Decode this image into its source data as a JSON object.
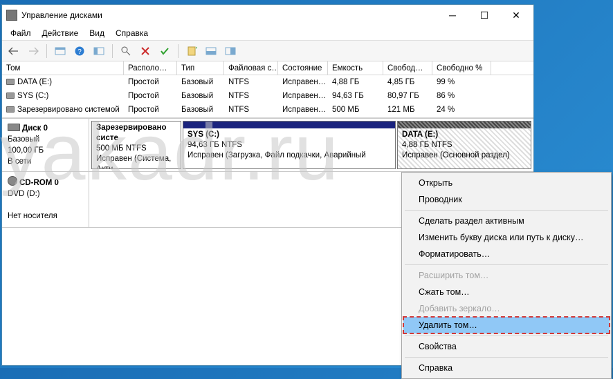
{
  "window": {
    "title": "Управление дисками"
  },
  "menubar": [
    "Файл",
    "Действие",
    "Вид",
    "Справка"
  ],
  "columns": {
    "volume": "Том",
    "location": "Располо…",
    "type": "Тип",
    "fs": "Файловая с…",
    "state": "Состояние",
    "capacity": "Емкость",
    "free": "Свобод…",
    "freePct": "Свободно %"
  },
  "volumes": [
    {
      "name": "DATA (E:)",
      "location": "Простой",
      "type": "Базовый",
      "fs": "NTFS",
      "state": "Исправен…",
      "capacity": "4,88 ГБ",
      "free": "4,85 ГБ",
      "freePct": "99 %"
    },
    {
      "name": "SYS (C:)",
      "location": "Простой",
      "type": "Базовый",
      "fs": "NTFS",
      "state": "Исправен…",
      "capacity": "94,63 ГБ",
      "free": "80,97 ГБ",
      "freePct": "86 %"
    },
    {
      "name": "Зарезервировано системой",
      "location": "Простой",
      "type": "Базовый",
      "fs": "NTFS",
      "state": "Исправен…",
      "capacity": "500 МБ",
      "free": "121 МБ",
      "freePct": "24 %"
    }
  ],
  "disk0": {
    "label": "Диск 0",
    "type": "Базовый",
    "size": "100,00 ГБ",
    "status": "В сети",
    "partitions": [
      {
        "title": "Зарезервировано систе",
        "sub": "500 МБ NTFS",
        "state": "Исправен (Система, Акти"
      },
      {
        "title": "SYS  (C:)",
        "sub": "94,63 ГБ NTFS",
        "state": "Исправен (Загрузка, Файл подкачки, Аварийный"
      },
      {
        "title": "DATA  (E:)",
        "sub": "4,88 ГБ NTFS",
        "state": "Исправен (Основной раздел)"
      }
    ]
  },
  "cdrom": {
    "label": "CD-ROM 0",
    "sub": "DVD (D:)",
    "status": "Нет носителя"
  },
  "context_menu": [
    {
      "label": "Открыть",
      "enabled": true
    },
    {
      "label": "Проводник",
      "enabled": true
    },
    {
      "sep": true
    },
    {
      "label": "Сделать раздел активным",
      "enabled": true
    },
    {
      "label": "Изменить букву диска или путь к диску…",
      "enabled": true
    },
    {
      "label": "Форматировать…",
      "enabled": true
    },
    {
      "sep": true
    },
    {
      "label": "Расширить том…",
      "enabled": false
    },
    {
      "label": "Сжать том…",
      "enabled": true
    },
    {
      "label": "Добавить зеркало…",
      "enabled": false
    },
    {
      "label": "Удалить том…",
      "enabled": true,
      "hl": true,
      "boxed": true
    },
    {
      "sep": true
    },
    {
      "label": "Свойства",
      "enabled": true
    },
    {
      "sep": true
    },
    {
      "label": "Справка",
      "enabled": true
    }
  ],
  "watermark": "yakadr.ru"
}
